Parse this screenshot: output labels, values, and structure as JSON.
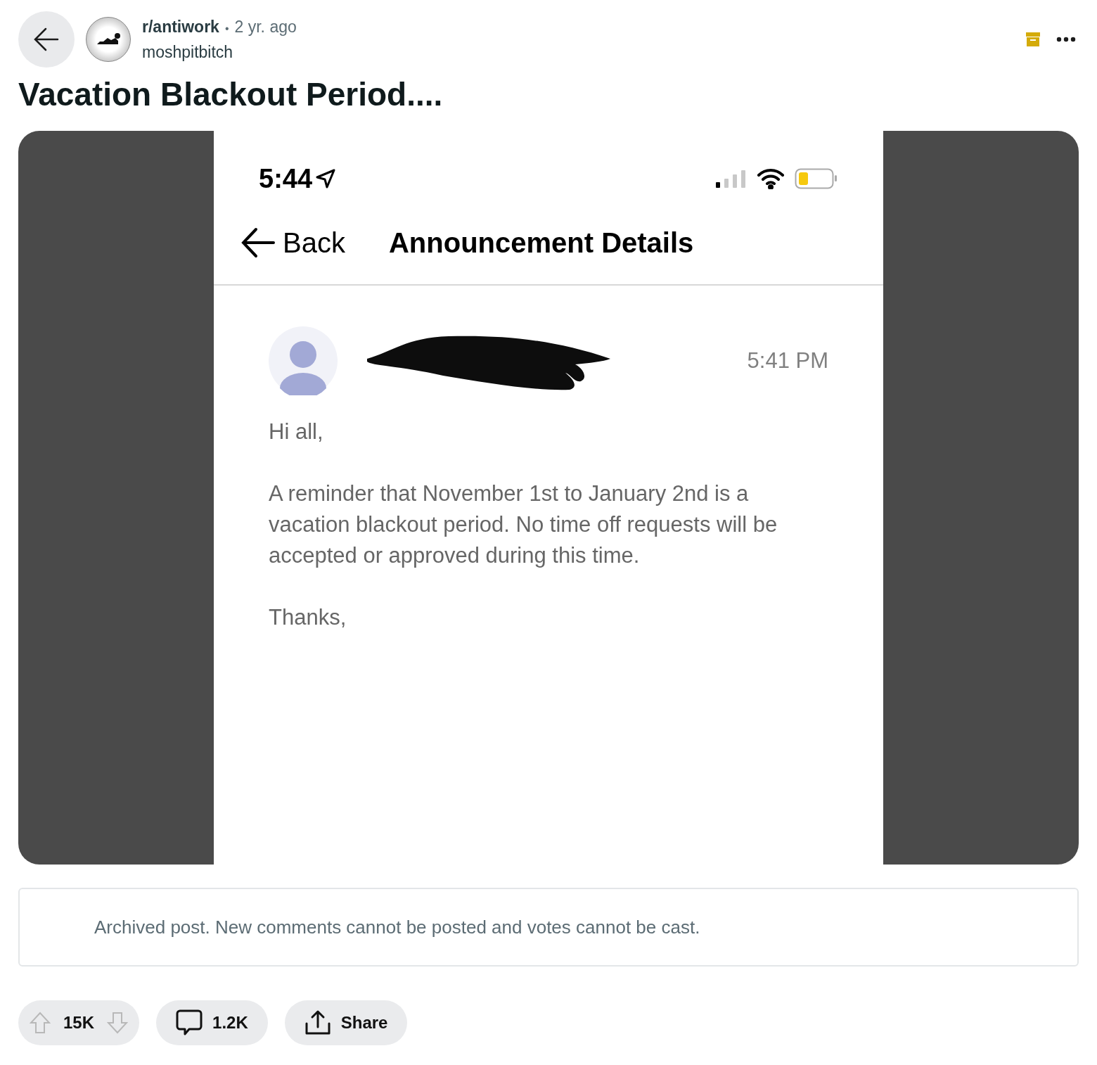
{
  "post": {
    "subreddit": "r/antiwork",
    "separator": "•",
    "age": "2 yr. ago",
    "author": "moshpitbitch",
    "title": "Vacation Blackout Period....",
    "archived": true
  },
  "screenshot": {
    "time": "5:44",
    "back": "Back",
    "heading": "Announcement Details",
    "sent_at": "5:41 PM",
    "paragraphs": [
      "Hi all,",
      "A reminder that November 1st to January 2nd is a vacation blackout period. No time off requests will be accepted or approved during this time.",
      "Thanks,"
    ]
  },
  "notice": "Archived post. New comments cannot be posted and votes cannot be cast.",
  "actions": {
    "votes": "15K",
    "votes_disabled": true,
    "comments": "1.2K",
    "share": "Share"
  }
}
